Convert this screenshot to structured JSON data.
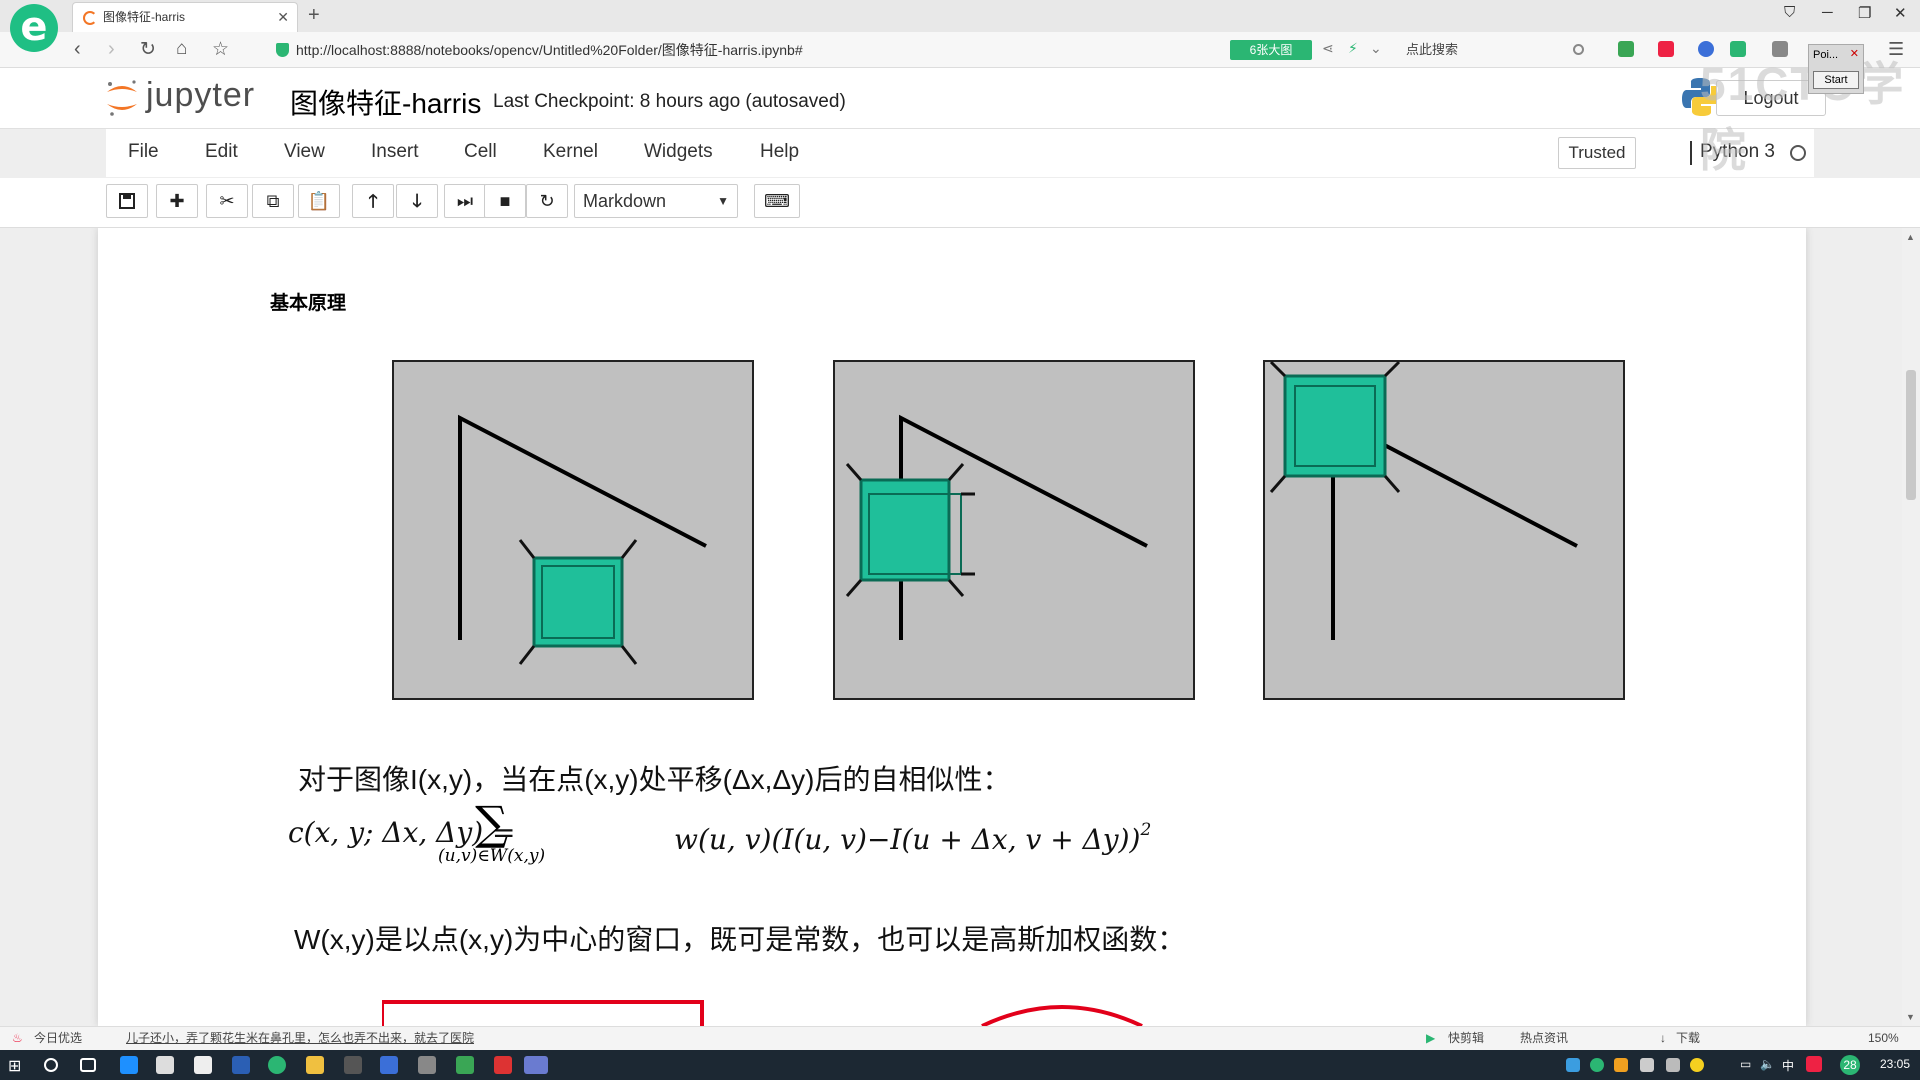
{
  "browser": {
    "tab_title": "图像特征-harris",
    "url": "http://localhost:8888/notebooks/opencv/Untitled%20Folder/图像特征-harris.ipynb#",
    "url_badge": "6张大图",
    "search_placeholder": "点此搜索"
  },
  "jupyter": {
    "logo_text": "jupyter",
    "notebook_title": "图像特征-harris",
    "checkpoint": "Last Checkpoint: 8 hours ago (autosaved)",
    "logout_label": "Logout",
    "menu": [
      "File",
      "Edit",
      "View",
      "Insert",
      "Cell",
      "Kernel",
      "Widgets",
      "Help"
    ],
    "trusted_label": "Trusted",
    "kernel_name": "Python 3",
    "cell_type": "Markdown"
  },
  "content": {
    "heading": "基本原理",
    "para1": "对于图像I(x,y)，当在点(x,y)处平移(Δx,Δy)后的自相似性：",
    "formula_lhs": "c(x, y; Δx, Δy) =",
    "formula_sum": "∑",
    "formula_sub": "(u,v)∈W(x,y)",
    "formula_rhs": "w(u, v)(I(u, v)−I(u + Δx, v + Δy))",
    "formula_exp": "2",
    "para2": "W(x,y)是以点(x,y)为中心的窗口，既可是常数，也可以是高斯加权函数："
  },
  "overlay": {
    "win_title": "Poi...",
    "start_label": "Start",
    "watermark": "51CTO学院"
  },
  "statusbar": {
    "left1": "今日优选",
    "left2": "儿子还小，弄了颗花生米在鼻孔里，怎么也弄不出来，就去了医院",
    "right": [
      "快剪辑",
      "热点资讯",
      "下载"
    ],
    "zoom": "150%"
  },
  "taskbar": {
    "ime": "中",
    "time": "23:05",
    "badge": "28"
  },
  "colors": {
    "jupyter_orange": "#f37626",
    "window_green": "#1fbf9a",
    "panel_gray": "#c0c0c0",
    "browser_green": "#1fbf84"
  }
}
